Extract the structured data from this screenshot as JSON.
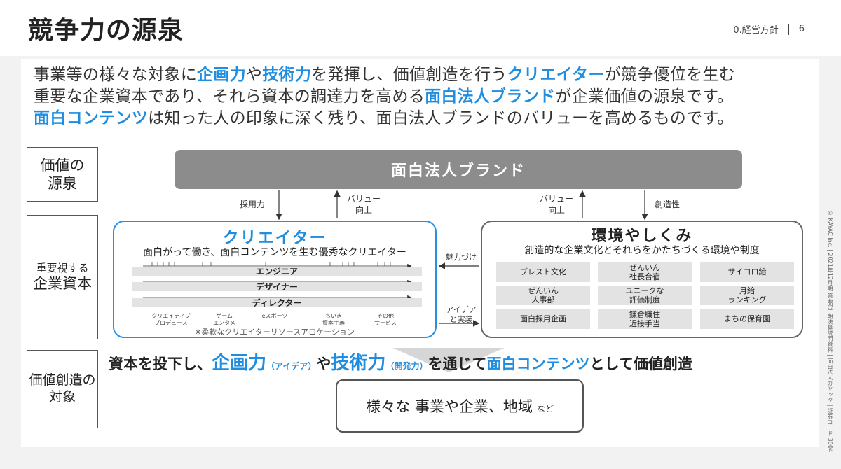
{
  "header": {
    "title": "競争力の源泉",
    "section": "0.経営方針",
    "page": "6"
  },
  "intro": {
    "l1a": "事業等の様々な対象に",
    "l1b": "企画力",
    "l1c": "や",
    "l1d": "技術力",
    "l1e": "を発揮し、価値創造を行う",
    "l1f": "クリエイター",
    "l1g": "が競争優位を生む",
    "l2a": "重要な企業資本であり、それら資本の調達力を高める",
    "l2b": "面白法人ブランド",
    "l2c": "が企業価値の源泉です。",
    "l3a": "面白コンテンツ",
    "l3b": "は知った人の印象に深く残り、面白法人ブランドのバリューを高めるものです。"
  },
  "side": {
    "source": "価値の\n源泉",
    "capital_a": "重要視する",
    "capital_b": "企業資本",
    "target": "価値創造の\n対象"
  },
  "brand": "面白法人ブランド",
  "arrows": {
    "hiring": "採用力",
    "value_up_left": "バリュー\n向上",
    "value_up_right": "バリュー\n向上",
    "creativity": "創造性",
    "attraction": "魅力づけ",
    "ideas": "アイデア\nと実装"
  },
  "creator": {
    "title": "クリエイター",
    "subtitle": "面白がって働き、面白コンテンツを生む優秀なクリエイター",
    "roles": [
      "エンジニア",
      "デザイナー",
      "ディレクター"
    ],
    "categories": [
      "クリエイティブ\nプロデュース",
      "ゲーム\nエンタメ",
      "eスポーツ",
      "ちいき\n資本主義",
      "その他\nサービス"
    ],
    "note": "※柔軟なクリエイターリソースアロケーション"
  },
  "env": {
    "title": "環境やしくみ",
    "subtitle": "創造的な企業文化とそれらをかたちづくる環境や制度",
    "cells": [
      "ブレスト文化",
      "ぜんいん\n社長合宿",
      "サイコロ給",
      "ぜんいん\n人事部",
      "ユニークな\n評価制度",
      "月給\nランキング",
      "面白採用企画",
      "鎌倉職住\n近接手当",
      "まちの保育園"
    ]
  },
  "invest": {
    "a": "資本を投下し、",
    "b": "企画力",
    "c": "（アイデア）",
    "d": "や",
    "e": "技術力",
    "f": "（開発力）",
    "g": "を通じて",
    "h": "面白コンテンツ",
    "i": "として価値創造"
  },
  "target": {
    "main": "様々な 事業や企業、地域",
    "suffix": "など"
  },
  "vertical_note": "© KAYAC Inc. | 2021年12月期 第4四半期決算説明資料 | 面白法人カヤック | 証券コード:3904",
  "colors": {
    "accent": "#1f8ee0",
    "brand_bg": "#8c8c8c"
  }
}
